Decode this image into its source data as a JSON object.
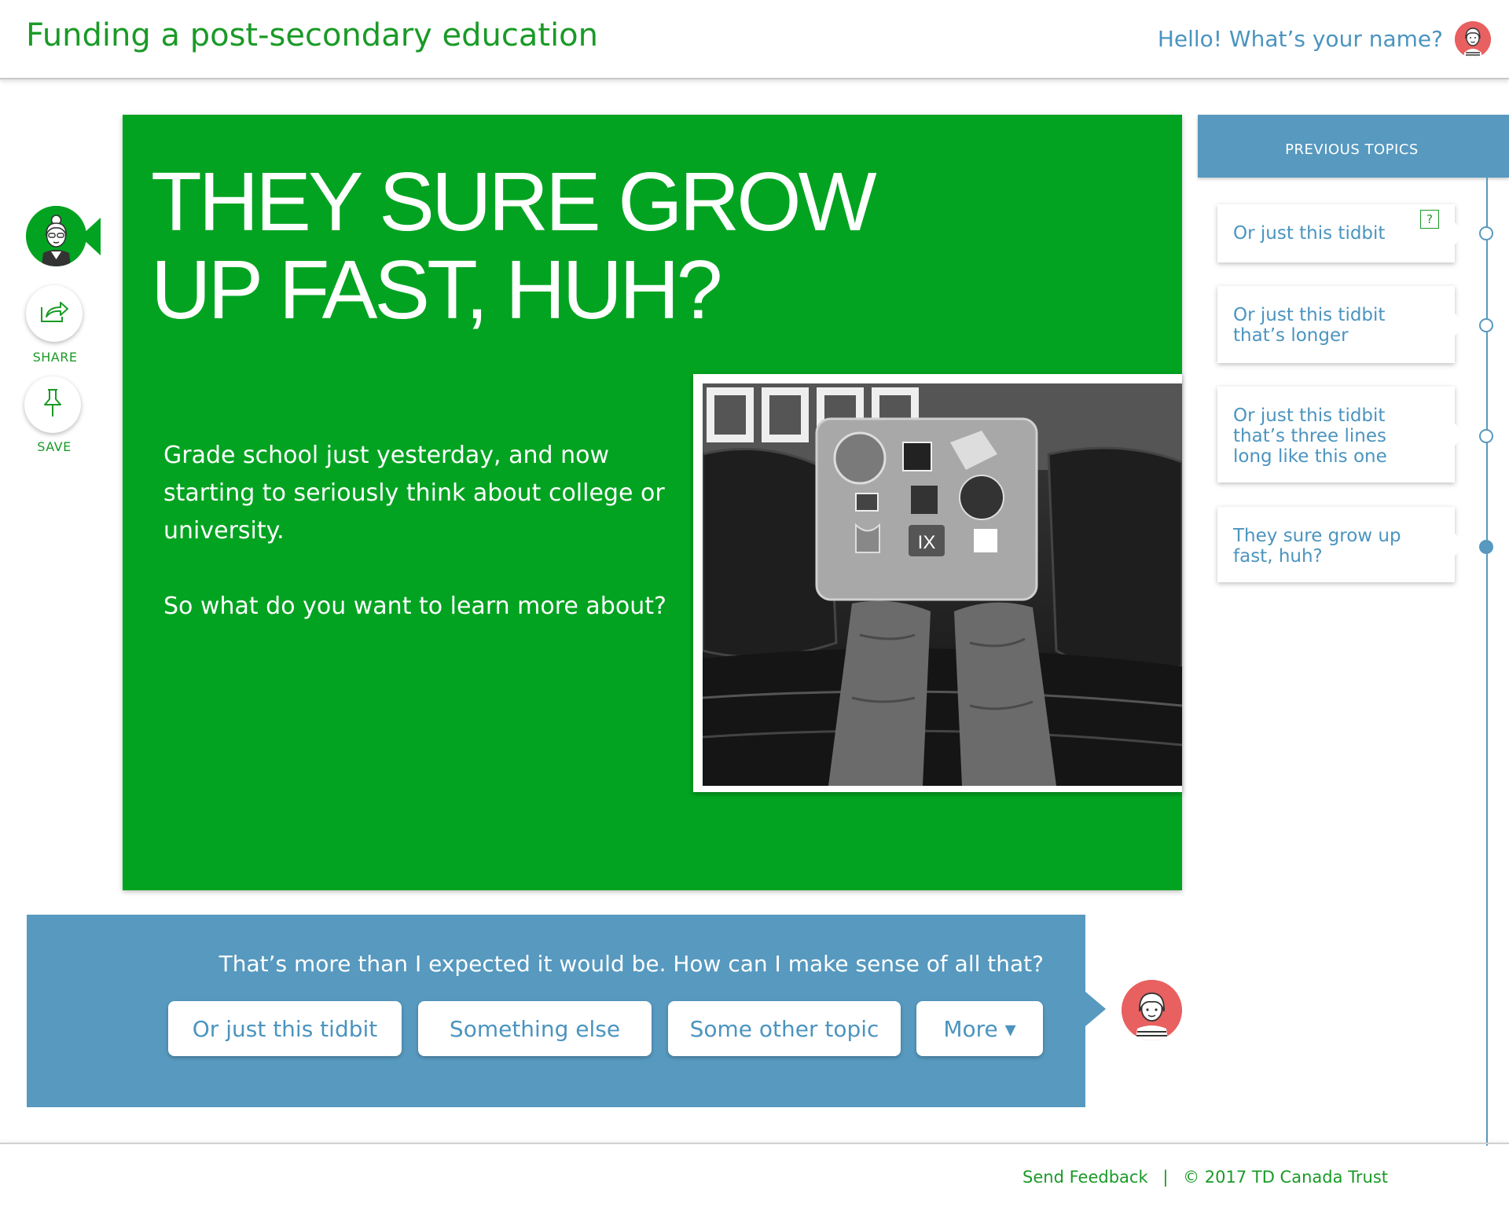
{
  "header": {
    "title": "Funding a post-secondary education",
    "greeting": "Hello! What’s your name?"
  },
  "sidebar": {
    "share_label": "SHARE",
    "save_label": "SAVE"
  },
  "card": {
    "headline_line1": "THEY SURE GROW",
    "headline_line2": "UP FAST, HUH?",
    "paragraph1": "Grade school just yesterday, and now starting to seriously think about college or university.",
    "paragraph2": "So what do you want to learn more about?"
  },
  "reply": {
    "question": "That’s more than I expected it would be. How can I make sense of all that?",
    "options": [
      "Or just this tidbit",
      "Something else",
      "Some other topic",
      "More ▾"
    ]
  },
  "topics": {
    "header": "PREVIOUS TOPICS",
    "help_symbol": "?",
    "items": [
      {
        "text": "Or just this tidbit",
        "active": false
      },
      {
        "text": "Or just this tidbit that’s longer",
        "active": false
      },
      {
        "text": "Or just this tidbit that’s three lines long like this one",
        "active": false
      },
      {
        "text": "They sure grow up fast, huh?",
        "active": true
      }
    ]
  },
  "footer": {
    "feedback": "Send Feedback",
    "separator": "|",
    "copyright": "© 2017 TD Canada Trust"
  },
  "colors": {
    "green": "#02a321",
    "blue": "#5799bf",
    "text_blue": "#4b94bf",
    "avatar_red": "#e86060"
  }
}
